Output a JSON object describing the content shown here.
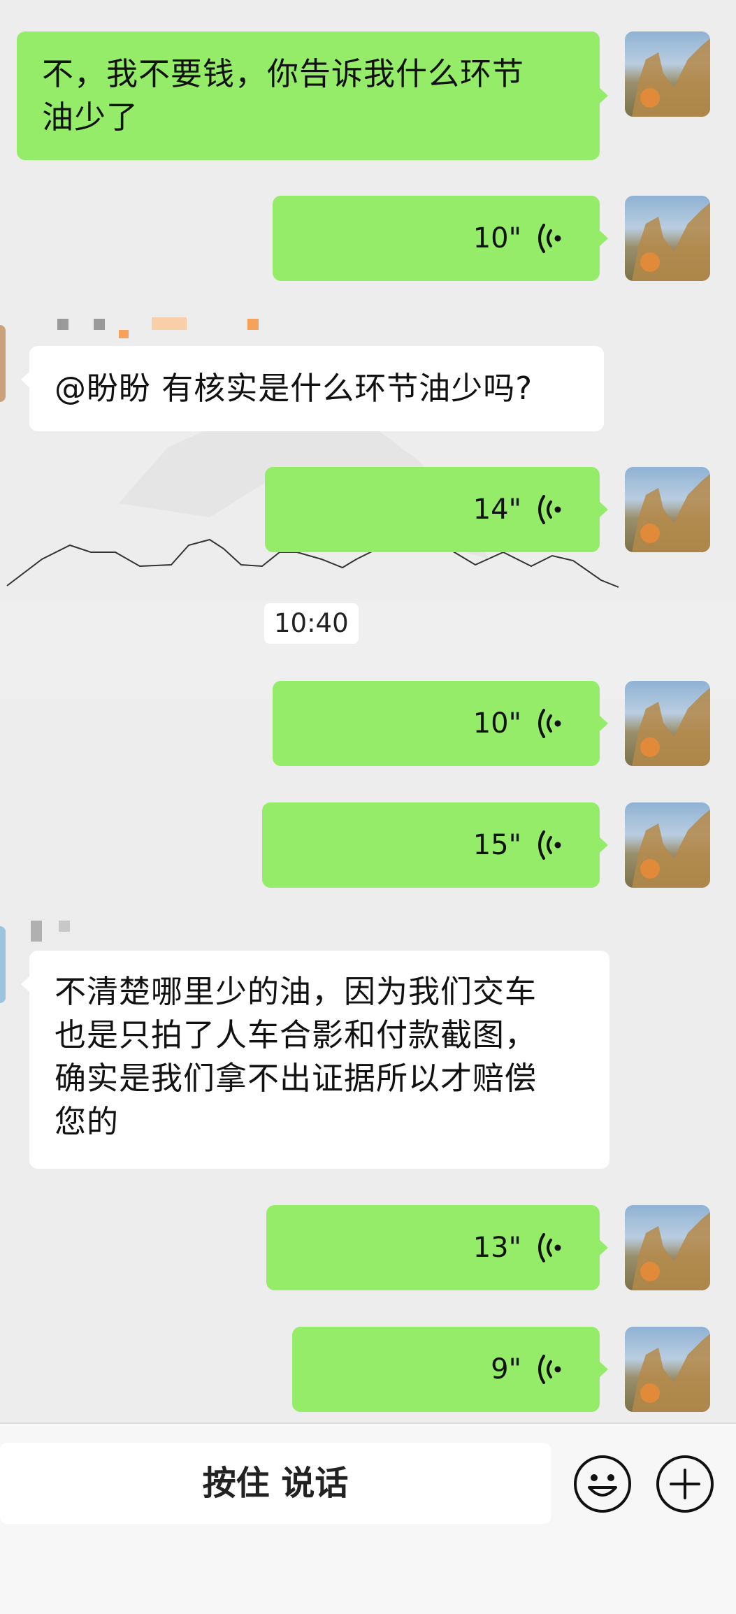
{
  "messages": [
    {
      "id": "m1",
      "direction": "out",
      "type": "text",
      "lines": [
        "不，我不要钱，你告诉我什么环节",
        "油少了"
      ]
    },
    {
      "id": "m2",
      "direction": "out",
      "type": "voice",
      "duration": "10\""
    },
    {
      "id": "m3",
      "direction": "in",
      "type": "text",
      "lines": [
        "@盼盼 有核实是什么环节油少吗?"
      ]
    },
    {
      "id": "m4",
      "direction": "out",
      "type": "voice",
      "duration": "14\""
    },
    {
      "id": "m5",
      "direction": "out",
      "type": "voice",
      "duration": "10\""
    },
    {
      "id": "m6",
      "direction": "out",
      "type": "voice",
      "duration": "15\""
    },
    {
      "id": "m7",
      "direction": "in",
      "type": "text",
      "lines": [
        "不清楚哪里少的油，因为我们交车",
        "也是只拍了人车合影和付款截图，",
        "确实是我们拿不出证据所以才赔偿",
        "您的"
      ]
    },
    {
      "id": "m8",
      "direction": "out",
      "type": "voice",
      "duration": "13\""
    },
    {
      "id": "m9",
      "direction": "out",
      "type": "voice",
      "duration": "9\""
    }
  ],
  "timestamp": "10:40",
  "input_bar": {
    "hold_to_talk_label": "按住 说话",
    "emoji_icon": "smiley-icon",
    "more_icon": "plus-circle-icon"
  },
  "colors": {
    "outgoing_bubble": "#95ec69",
    "incoming_bubble": "#ffffff",
    "background": "#ededed",
    "accent_orange": "#f6a25a"
  }
}
